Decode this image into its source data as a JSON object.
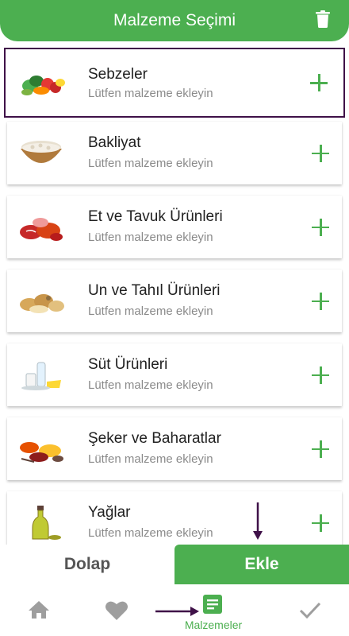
{
  "header": {
    "title": "Malzeme Seçimi"
  },
  "categories": [
    {
      "name": "Sebzeler",
      "hint": "Lütfen malzeme ekleyin"
    },
    {
      "name": "Bakliyat",
      "hint": "Lütfen malzeme ekleyin"
    },
    {
      "name": "Et ve Tavuk Ürünleri",
      "hint": "Lütfen malzeme ekleyin"
    },
    {
      "name": "Un ve Tahıl Ürünleri",
      "hint": "Lütfen malzeme ekleyin"
    },
    {
      "name": "Süt Ürünleri",
      "hint": "Lütfen malzeme ekleyin"
    },
    {
      "name": "Şeker ve Baharatlar",
      "hint": "Lütfen malzeme ekleyin"
    },
    {
      "name": "Yağlar",
      "hint": "Lütfen malzeme ekleyin"
    }
  ],
  "actions": {
    "dolap": "Dolap",
    "ekle": "Ekle"
  },
  "nav": {
    "list_label": "Malzemeler"
  },
  "colors": {
    "primary": "#4caf50",
    "selected_border": "#3f1148",
    "annotation": "#3f1148",
    "inactive_icon": "#9e9e9e"
  }
}
